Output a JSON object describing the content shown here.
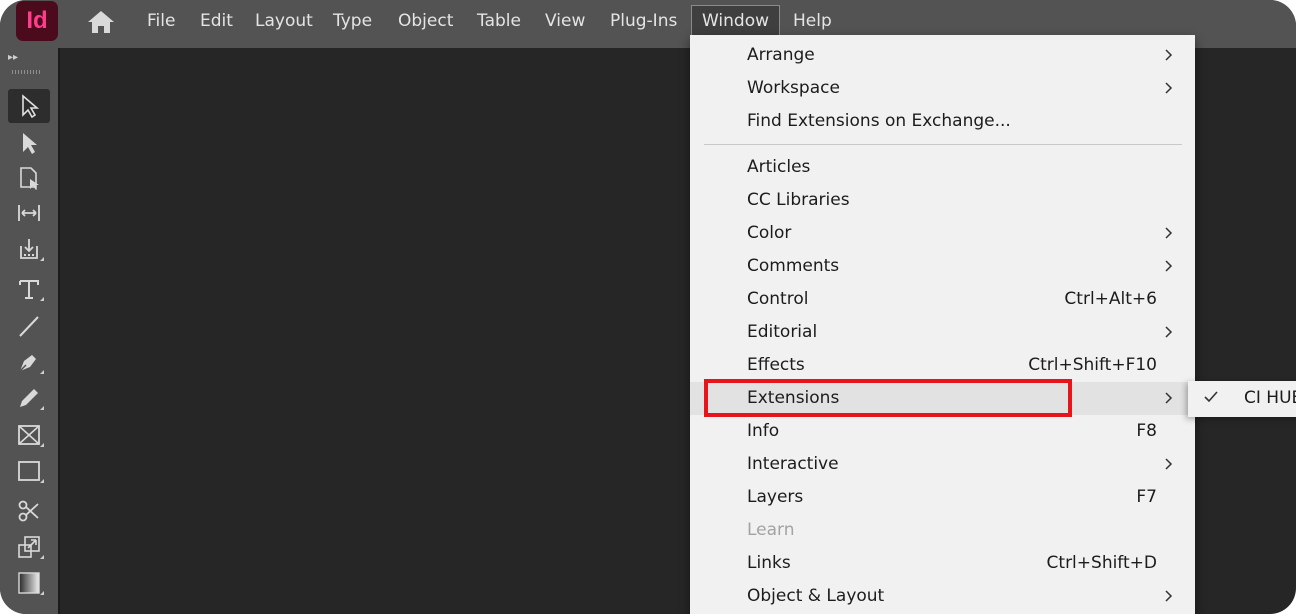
{
  "app": {
    "logo_text": "Id"
  },
  "menubar": {
    "items": [
      "File",
      "Edit",
      "Layout",
      "Type",
      "Object",
      "Table",
      "View",
      "Plug-Ins",
      "Window",
      "Help"
    ],
    "active": "Window"
  },
  "window_menu": {
    "items": [
      {
        "label": "Arrange",
        "shortcut": "",
        "submenu": true
      },
      {
        "label": "Workspace",
        "shortcut": "",
        "submenu": true
      },
      {
        "label": "Find Extensions on Exchange...",
        "shortcut": "",
        "submenu": false
      },
      {
        "label": "Articles",
        "shortcut": "",
        "submenu": false
      },
      {
        "label": "CC Libraries",
        "shortcut": "",
        "submenu": false
      },
      {
        "label": "Color",
        "shortcut": "",
        "submenu": true
      },
      {
        "label": "Comments",
        "shortcut": "",
        "submenu": true
      },
      {
        "label": "Control",
        "shortcut": "Ctrl+Alt+6",
        "submenu": false
      },
      {
        "label": "Editorial",
        "shortcut": "",
        "submenu": true
      },
      {
        "label": "Effects",
        "shortcut": "Ctrl+Shift+F10",
        "submenu": false
      },
      {
        "label": "Extensions",
        "shortcut": "",
        "submenu": true,
        "highlighted": true
      },
      {
        "label": "Info",
        "shortcut": "F8",
        "submenu": false
      },
      {
        "label": "Interactive",
        "shortcut": "",
        "submenu": true
      },
      {
        "label": "Layers",
        "shortcut": "F7",
        "submenu": false
      },
      {
        "label": "Learn",
        "shortcut": "",
        "submenu": false,
        "disabled": true
      },
      {
        "label": "Links",
        "shortcut": "Ctrl+Shift+D",
        "submenu": false
      },
      {
        "label": "Object & Layout",
        "shortcut": "",
        "submenu": true
      }
    ]
  },
  "extensions_submenu": {
    "items": [
      {
        "label": "CI HUB",
        "checked": true
      }
    ]
  },
  "colors": {
    "annotation": "#e8141b",
    "logo_bg": "#4c0a1d",
    "logo_fg": "#ff3d8b"
  }
}
